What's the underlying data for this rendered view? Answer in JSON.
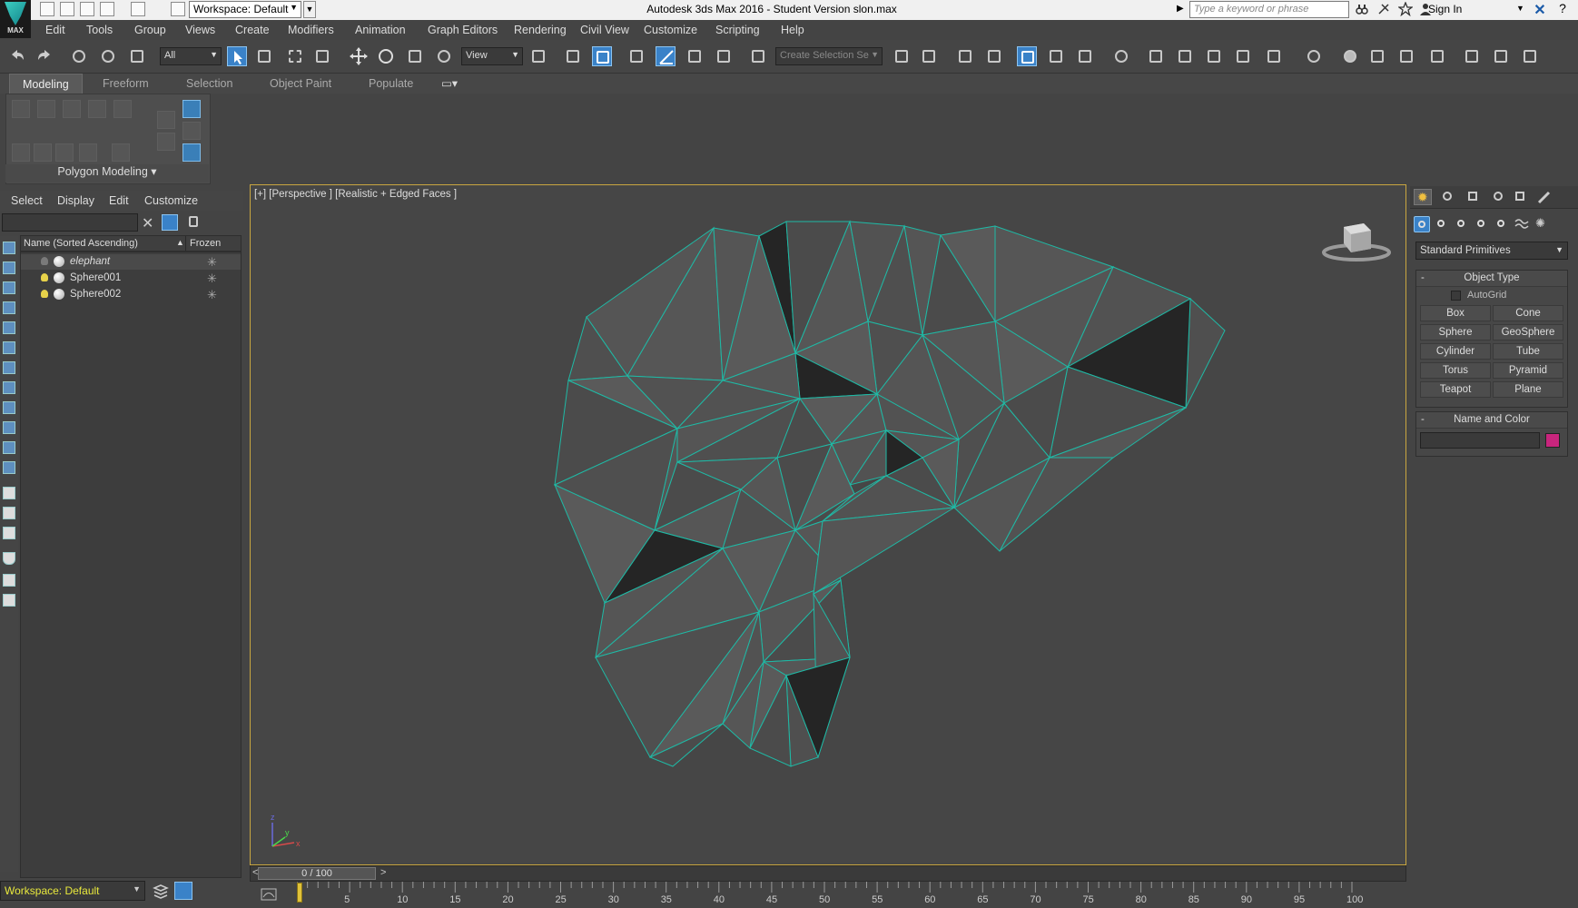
{
  "titlebar": {
    "workspace": "Workspace: Default",
    "title": "Autodesk 3ds Max 2016 - Student Version    slon.max",
    "search_placeholder": "Type a keyword or phrase",
    "sign_in": "Sign In",
    "logo_text": "MAX"
  },
  "menubar": [
    "Edit",
    "Tools",
    "Group",
    "Views",
    "Create",
    "Modifiers",
    "Animation",
    "Graph Editors",
    "Rendering",
    "Civil View",
    "Customize",
    "Scripting",
    "Help"
  ],
  "toolbar": {
    "selection_filter": "All",
    "reference_coord": "View",
    "selection_set_placeholder": "Create Selection Se"
  },
  "ribbon": {
    "tabs": [
      "Modeling",
      "Freeform",
      "Selection",
      "Object Paint",
      "Populate"
    ],
    "active_tab": "Modeling",
    "panel_label": "Polygon Modeling"
  },
  "scene_explorer": {
    "menu": [
      "Select",
      "Display",
      "Edit",
      "Customize"
    ],
    "col_name": "Name (Sorted Ascending)",
    "col_frozen": "Frozen",
    "rows": [
      {
        "name": "elephant",
        "light": "off"
      },
      {
        "name": "Sphere001",
        "light": "on"
      },
      {
        "name": "Sphere002",
        "light": "on"
      }
    ],
    "workspace": "Workspace: Default"
  },
  "viewport": {
    "label": "[+] [Perspective ] [Realistic + Edged Faces ]",
    "wire_color": "#1fb9a5",
    "axis_labels": {
      "x": "x",
      "y": "y",
      "z": "z"
    }
  },
  "timeline": {
    "frame": "0 / 100",
    "ticks": [
      "5",
      "10",
      "15",
      "20",
      "25",
      "30",
      "35",
      "40",
      "45",
      "50",
      "55",
      "60",
      "65",
      "70",
      "75",
      "80",
      "85",
      "90",
      "95",
      "100"
    ]
  },
  "command_panel": {
    "category": "Standard Primitives",
    "object_type_title": "Object Type",
    "autogrid": "AutoGrid",
    "buttons": [
      "Box",
      "Cone",
      "Sphere",
      "GeoSphere",
      "Cylinder",
      "Tube",
      "Torus",
      "Pyramid",
      "Teapot",
      "Plane"
    ],
    "name_color_title": "Name and Color",
    "object_color": "#c8257d"
  }
}
